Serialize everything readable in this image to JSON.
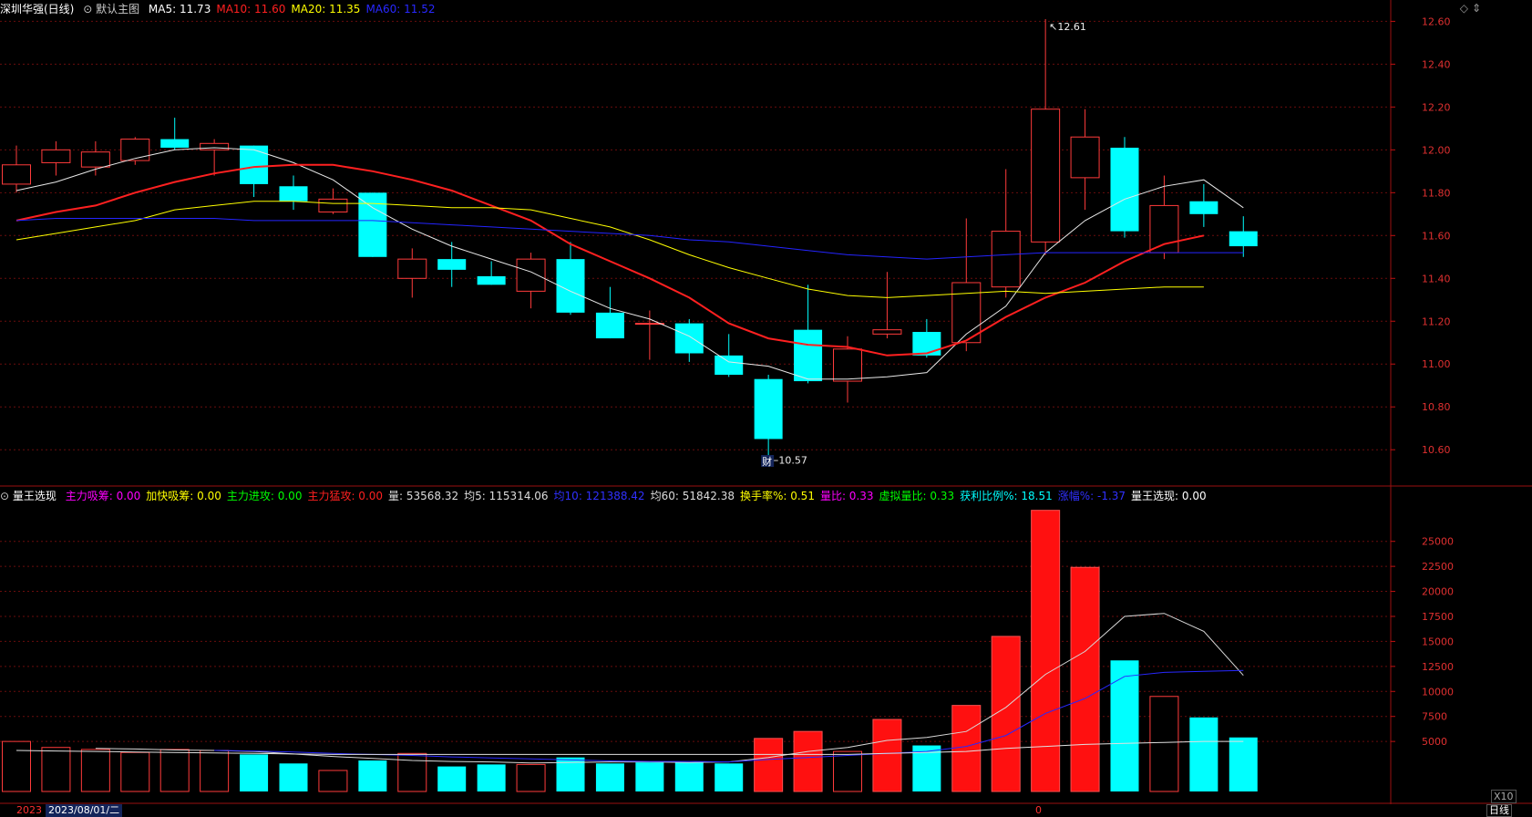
{
  "header": {
    "stock": "深圳华强(日线)",
    "template": "默认主图",
    "ma": [
      {
        "label": "MA5: 11.73",
        "color": "#ffffff"
      },
      {
        "label": "MA10: 11.60",
        "color": "#ff2020"
      },
      {
        "label": "MA20: 11.35",
        "color": "#ffff00"
      },
      {
        "label": "MA60: 11.52",
        "color": "#2828ff"
      }
    ]
  },
  "indicator": {
    "name": "量王选现",
    "items": [
      {
        "label": "主力吸筹: 0.00",
        "color": "#ff00ff"
      },
      {
        "label": "加快吸筹: 0.00",
        "color": "#ffff00"
      },
      {
        "label": "主力进攻: 0.00",
        "color": "#00ff00"
      },
      {
        "label": "主力猛攻: 0.00",
        "color": "#ff2020"
      },
      {
        "label": "量: 53568.32",
        "color": "#dddddd"
      },
      {
        "label": "均5: 115314.06",
        "color": "#dddddd"
      },
      {
        "label": "均10: 121388.42",
        "color": "#3030ff"
      },
      {
        "label": "均60: 51842.38",
        "color": "#dddddd"
      },
      {
        "label": "换手率%: 0.51",
        "color": "#ffff00"
      },
      {
        "label": "量比: 0.33",
        "color": "#ff00ff"
      },
      {
        "label": "虚拟量比: 0.33",
        "color": "#00ff00"
      },
      {
        "label": "获利比例%: 18.51",
        "color": "#00ffff"
      },
      {
        "label": "涨幅%: -1.37",
        "color": "#3030ff"
      },
      {
        "label": "量王选现: 0.00",
        "color": "#ffffff"
      }
    ]
  },
  "marks": {
    "high": "12.61",
    "low": "10.57",
    "finance": "财"
  },
  "bottom": {
    "date_left": "2023",
    "date_main": "2023/08/01/二",
    "marker": "0",
    "period": "日线",
    "x10": "X10"
  },
  "icons": {
    "diamond": "diamond-icon",
    "scroll": "scroll-arrows-icon"
  },
  "chart_data": [
    {
      "type": "candlestick",
      "price_axis": {
        "ticks": [
          "12.60",
          "12.40",
          "12.20",
          "12.00",
          "11.80",
          "11.60",
          "11.40",
          "11.20",
          "11.00",
          "10.80",
          "10.60"
        ],
        "min": 10.52,
        "max": 12.64
      },
      "candles": [
        {
          "o": 11.84,
          "h": 12.02,
          "l": 11.8,
          "c": 11.93
        },
        {
          "o": 11.94,
          "h": 12.04,
          "l": 11.88,
          "c": 12.0
        },
        {
          "o": 11.92,
          "h": 12.04,
          "l": 11.88,
          "c": 11.99
        },
        {
          "o": 11.95,
          "h": 12.06,
          "l": 11.93,
          "c": 12.05
        },
        {
          "o": 12.05,
          "h": 12.15,
          "l": 12.0,
          "c": 12.01
        },
        {
          "o": 12.0,
          "h": 12.05,
          "l": 11.88,
          "c": 12.03
        },
        {
          "o": 12.02,
          "h": 12.02,
          "l": 11.78,
          "c": 11.84
        },
        {
          "o": 11.83,
          "h": 11.88,
          "l": 11.72,
          "c": 11.76
        },
        {
          "o": 11.71,
          "h": 11.82,
          "l": 11.7,
          "c": 11.77
        },
        {
          "o": 11.8,
          "h": 11.8,
          "l": 11.5,
          "c": 11.5
        },
        {
          "o": 11.4,
          "h": 11.54,
          "l": 11.31,
          "c": 11.49
        },
        {
          "o": 11.49,
          "h": 11.57,
          "l": 11.36,
          "c": 11.44
        },
        {
          "o": 11.41,
          "h": 11.48,
          "l": 11.37,
          "c": 11.37
        },
        {
          "o": 11.34,
          "h": 11.52,
          "l": 11.26,
          "c": 11.49
        },
        {
          "o": 11.49,
          "h": 11.57,
          "l": 11.23,
          "c": 11.24
        },
        {
          "o": 11.24,
          "h": 11.36,
          "l": 11.12,
          "c": 11.12
        },
        {
          "o": 11.19,
          "h": 11.25,
          "l": 11.02,
          "c": 11.19
        },
        {
          "o": 11.19,
          "h": 11.21,
          "l": 11.01,
          "c": 11.05
        },
        {
          "o": 11.04,
          "h": 11.14,
          "l": 10.94,
          "c": 10.95
        },
        {
          "o": 10.93,
          "h": 10.95,
          "l": 10.57,
          "c": 10.65
        },
        {
          "o": 11.16,
          "h": 11.37,
          "l": 10.91,
          "c": 10.92
        },
        {
          "o": 10.92,
          "h": 11.13,
          "l": 10.82,
          "c": 11.07
        },
        {
          "o": 11.14,
          "h": 11.43,
          "l": 11.12,
          "c": 11.16
        },
        {
          "o": 11.15,
          "h": 11.21,
          "l": 11.03,
          "c": 11.04
        },
        {
          "o": 11.1,
          "h": 11.68,
          "l": 11.06,
          "c": 11.38
        },
        {
          "o": 11.36,
          "h": 11.91,
          "l": 11.31,
          "c": 11.62
        },
        {
          "o": 11.57,
          "h": 12.61,
          "l": 11.51,
          "c": 12.19
        },
        {
          "o": 11.87,
          "h": 12.19,
          "l": 11.72,
          "c": 12.06
        },
        {
          "o": 12.01,
          "h": 12.06,
          "l": 11.59,
          "c": 11.62
        },
        {
          "o": 11.52,
          "h": 11.88,
          "l": 11.49,
          "c": 11.74
        },
        {
          "o": 11.76,
          "h": 11.84,
          "l": 11.64,
          "c": 11.7
        },
        {
          "o": 11.62,
          "h": 11.69,
          "l": 11.5,
          "c": 11.55
        }
      ],
      "series": [
        {
          "name": "MA5",
          "color": "#e8e8e8",
          "values": [
            11.81,
            11.85,
            11.91,
            11.96,
            12.0,
            12.01,
            12.0,
            11.94,
            11.86,
            11.73,
            11.63,
            11.55,
            11.49,
            11.43,
            11.34,
            11.26,
            11.21,
            11.13,
            11.01,
            10.99,
            10.93,
            10.93,
            10.94,
            10.96,
            11.14,
            11.27,
            11.52,
            11.67,
            11.77,
            11.83,
            11.86,
            11.73
          ]
        },
        {
          "name": "MA10",
          "color": "#ff2020",
          "values": [
            11.67,
            11.71,
            11.74,
            11.8,
            11.85,
            11.89,
            11.92,
            11.93,
            11.93,
            11.9,
            11.86,
            11.81,
            11.74,
            11.67,
            11.56,
            11.48,
            11.4,
            11.31,
            11.19,
            11.12,
            11.09,
            11.08,
            11.04,
            11.05,
            11.11,
            11.22,
            11.31,
            11.38,
            11.48,
            11.56,
            11.6
          ]
        },
        {
          "name": "MA20",
          "color": "#ffff00",
          "values": [
            11.58,
            11.61,
            11.64,
            11.67,
            11.72,
            11.74,
            11.76,
            11.76,
            11.75,
            11.75,
            11.74,
            11.73,
            11.73,
            11.72,
            11.68,
            11.64,
            11.58,
            11.51,
            11.45,
            11.4,
            11.35,
            11.32,
            11.31,
            11.32,
            11.33,
            11.34,
            11.33,
            11.34,
            11.35,
            11.36,
            11.36
          ]
        },
        {
          "name": "MA60",
          "color": "#2424ff",
          "values": [
            11.67,
            11.68,
            11.68,
            11.68,
            11.68,
            11.68,
            11.67,
            11.67,
            11.67,
            11.67,
            11.66,
            11.65,
            11.64,
            11.63,
            11.62,
            11.61,
            11.6,
            11.58,
            11.57,
            11.55,
            11.53,
            11.51,
            11.5,
            11.49,
            11.5,
            11.51,
            11.52,
            11.52,
            11.52,
            11.52,
            11.52,
            11.52
          ]
        }
      ]
    },
    {
      "type": "bar",
      "volume_axis": {
        "ticks": [
          "25000",
          "22500",
          "20000",
          "17500",
          "15000",
          "12500",
          "10000",
          "7500",
          "5000"
        ],
        "min": 0,
        "max": 28800
      },
      "volumes": [
        5000,
        4400,
        4200,
        3900,
        4200,
        4100,
        3700,
        2800,
        2100,
        3100,
        3800,
        2500,
        2700,
        2700,
        3400,
        2800,
        2900,
        2900,
        2800,
        5300,
        6000,
        4000,
        7200,
        4600,
        8600,
        15500,
        28100,
        22400,
        13100,
        9500,
        7400,
        5400
      ],
      "up": [
        true,
        true,
        true,
        true,
        true,
        true,
        false,
        false,
        true,
        false,
        true,
        false,
        false,
        true,
        false,
        false,
        false,
        false,
        false,
        false,
        false,
        true,
        true,
        false,
        true,
        true,
        true,
        true,
        false,
        true,
        false,
        false
      ],
      "color_override": [
        "",
        "",
        "",
        "",
        "",
        "",
        "",
        "",
        "",
        "",
        "",
        "",
        "",
        "",
        "",
        "",
        "",
        "",
        "",
        "red",
        "red",
        "",
        "red",
        "",
        "red",
        "red",
        "red",
        "red",
        "",
        "",
        "",
        ""
      ],
      "series": [
        {
          "name": "均5",
          "color": "#d8d8d8",
          "values": [
            null,
            null,
            4300,
            4250,
            4150,
            4100,
            4000,
            3750,
            3500,
            3300,
            3100,
            3000,
            2950,
            2850,
            2900,
            2950,
            2950,
            2900,
            2950,
            3400,
            4000,
            4400,
            5100,
            5400,
            6000,
            8400,
            11700,
            14000,
            17500,
            17800,
            16000,
            11600
          ]
        },
        {
          "name": "均10",
          "color": "#2828ff",
          "values": [
            null,
            null,
            null,
            null,
            null,
            4100,
            4050,
            3950,
            3800,
            3700,
            3600,
            3450,
            3350,
            3250,
            3150,
            3050,
            3000,
            3000,
            2950,
            3200,
            3400,
            3600,
            3800,
            4000,
            4500,
            5600,
            7800,
            9300,
            11500,
            11900,
            12000,
            12100
          ]
        },
        {
          "name": "均60",
          "color": "#e0e0e0",
          "values": [
            4100,
            4050,
            4000,
            3950,
            3900,
            3850,
            3800,
            3750,
            3700,
            3700,
            3700,
            3700,
            3700,
            3700,
            3700,
            3700,
            3700,
            3700,
            3700,
            3700,
            3700,
            3700,
            3800,
            3900,
            4000,
            4300,
            4500,
            4700,
            4800,
            4900,
            5000,
            5000
          ]
        }
      ]
    }
  ]
}
